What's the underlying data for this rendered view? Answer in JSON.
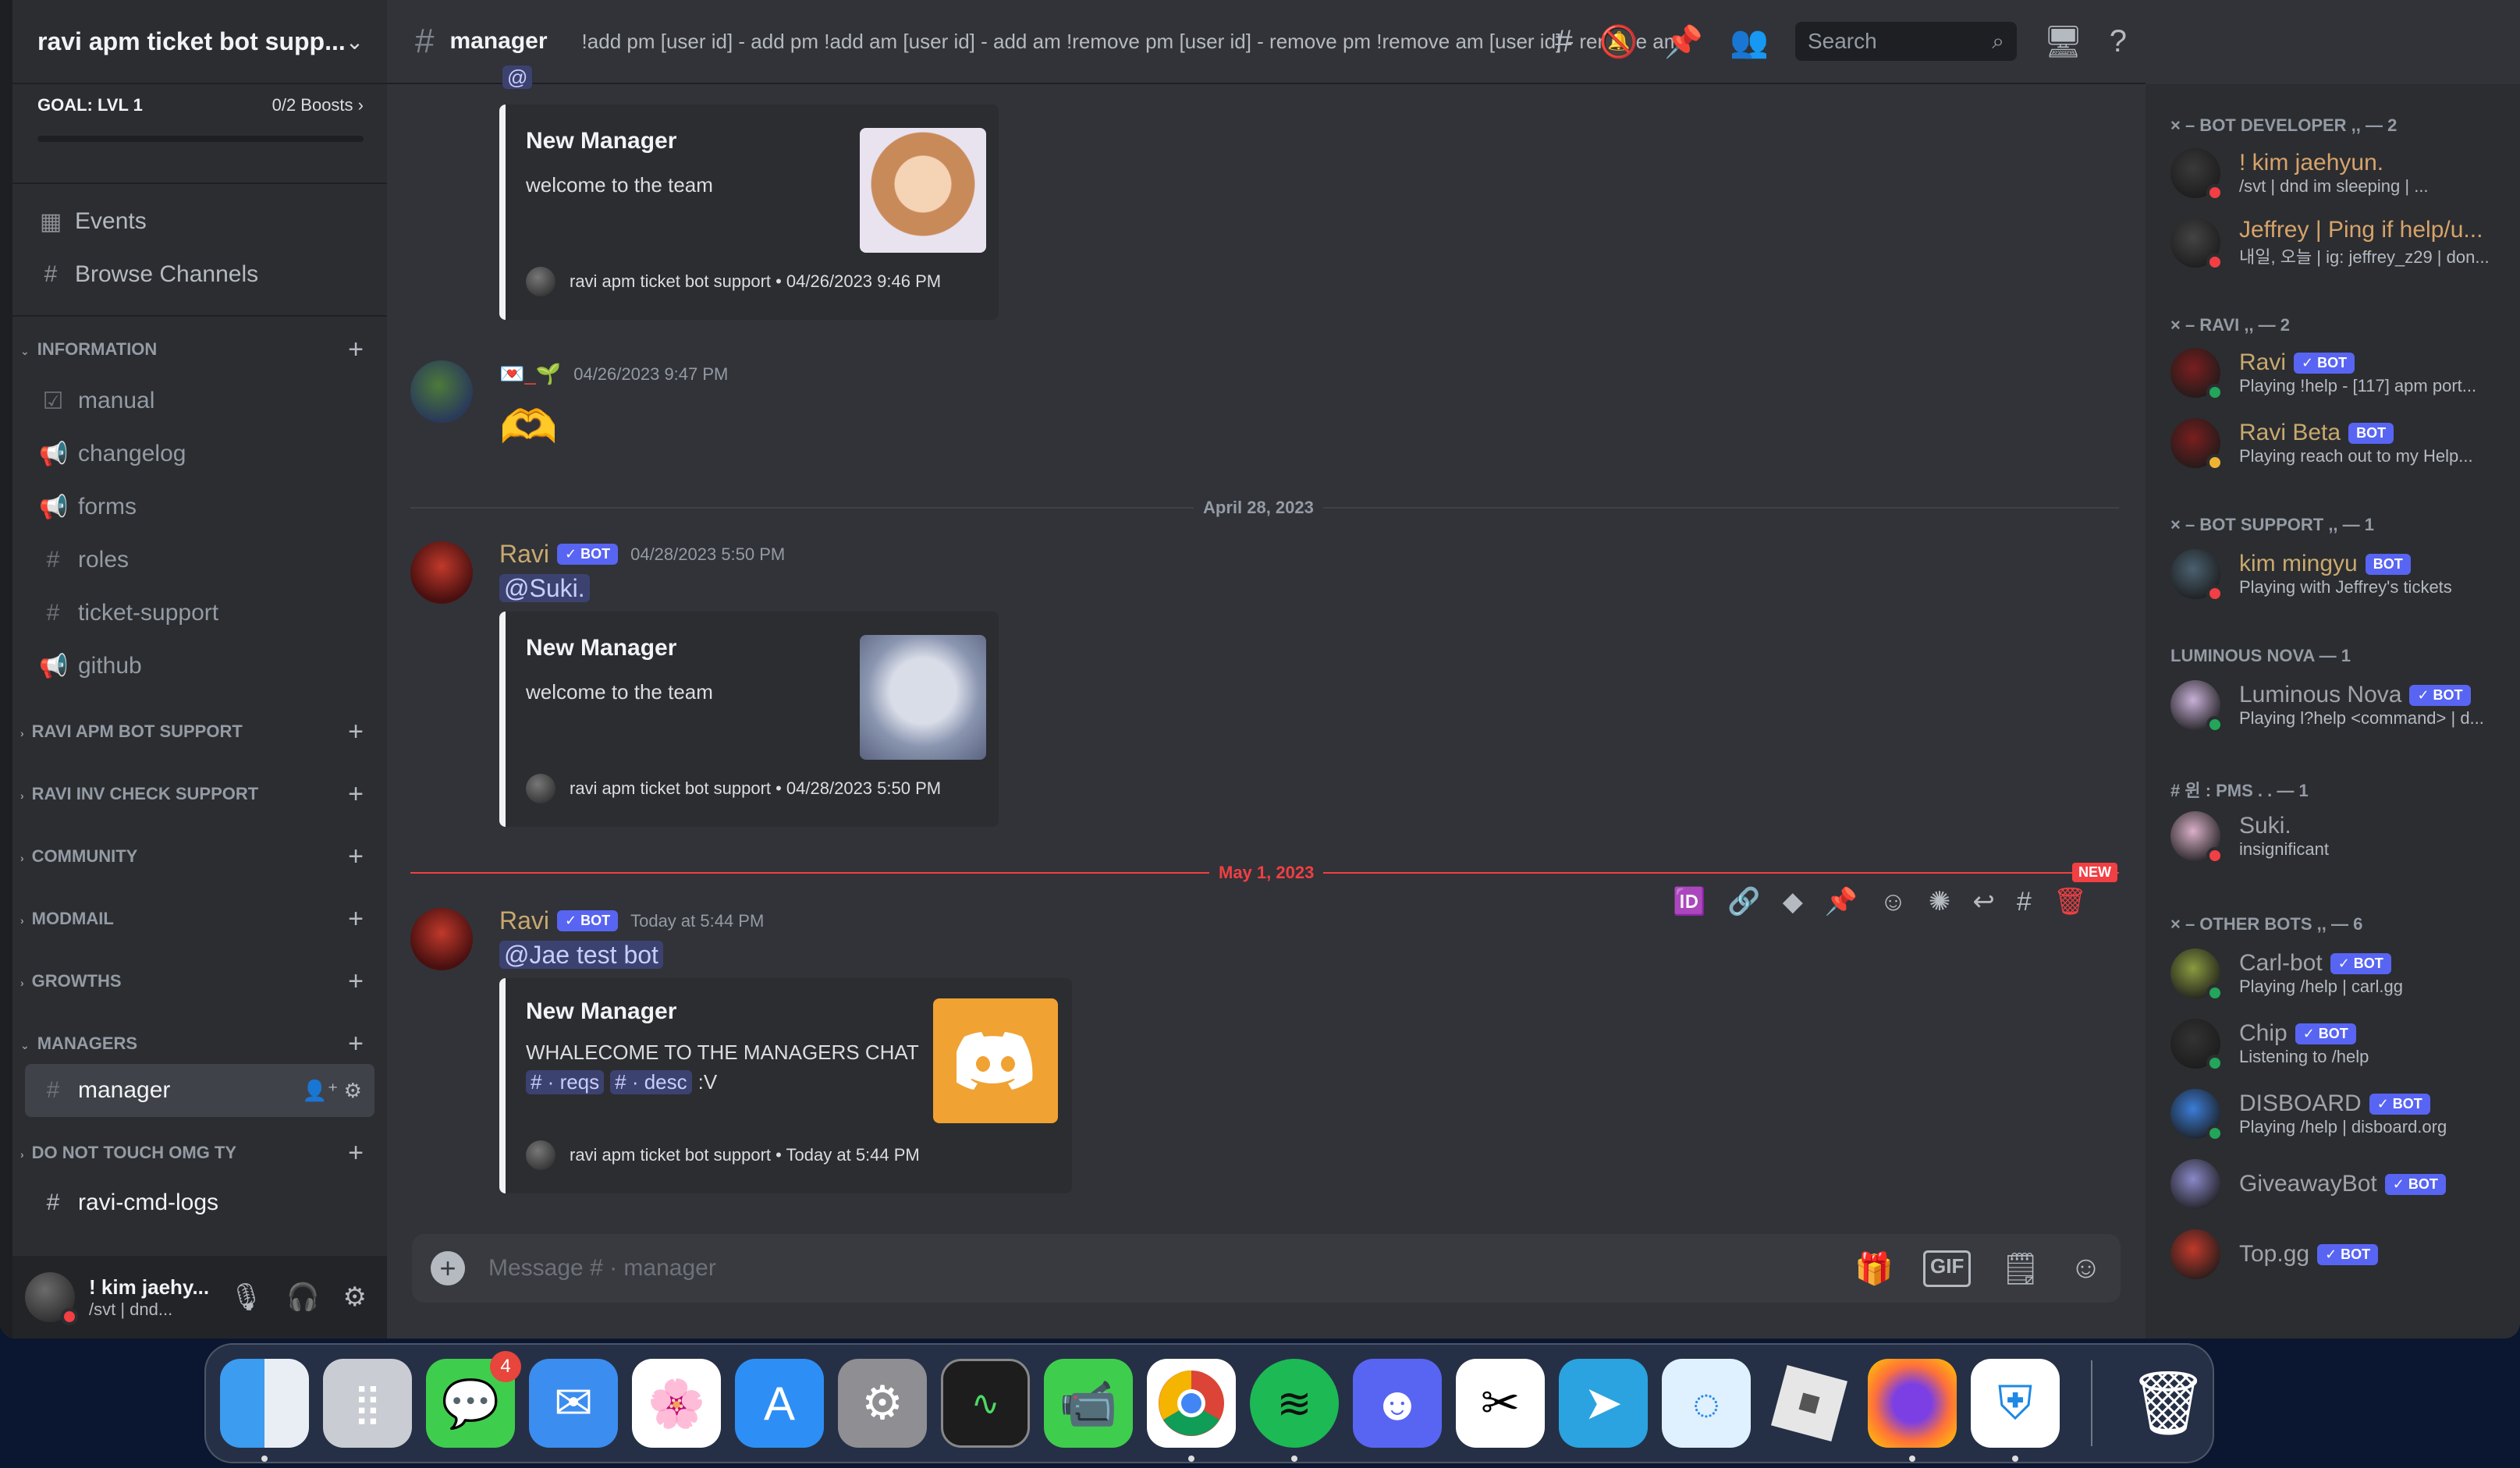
{
  "sidebar": {
    "server_name": "ravi apm ticket bot supp...",
    "goal_label": "GOAL: LVL 1",
    "goal_boosts": "0/2 Boosts",
    "links": [
      {
        "label": "Events",
        "icon": "calendar-icon"
      },
      {
        "label": "Browse Channels",
        "icon": "browse-channels-icon"
      }
    ],
    "info_category": "INFORMATION",
    "info_channels": [
      "manual",
      "changelog",
      "forms",
      "roles",
      "ticket-support",
      "github"
    ],
    "categories": [
      "RAVI APM BOT SUPPORT",
      "RAVI INV CHECK SUPPORT",
      "COMMUNITY",
      "MODMAIL",
      "GROWTHS",
      "MANAGERS"
    ],
    "active_channel": "manager",
    "last_category": "DO NOT TOUCH OMG TY",
    "last_channel": "ravi-cmd-logs",
    "user": {
      "name": "! kim jaehy...",
      "status": "/svt | dnd..."
    }
  },
  "header": {
    "channel": "manager",
    "topic": "!add pm [user id] - add pm !add am [user id] - add am !remove pm [user id] - remove pm !remove am [user id] - remove am",
    "search_placeholder": "Search"
  },
  "messages": {
    "m1": {
      "mention_partial": "@",
      "embed_title": "New Manager",
      "embed_desc": "welcome to the team",
      "embed_footer": "ravi apm ticket bot support • 04/26/2023 9:46 PM"
    },
    "m2": {
      "timestamp": "04/26/2023 9:47 PM",
      "emoji": "🫶"
    },
    "divider1": "April 28, 2023",
    "m3": {
      "author": "Ravi",
      "bot_tag": "✓ BOT",
      "timestamp": "04/28/2023 5:50 PM",
      "mention": "@Suki.",
      "embed_title": "New Manager",
      "embed_desc": "welcome to the team",
      "embed_footer": "ravi apm ticket bot support • 04/28/2023 5:50 PM"
    },
    "divider2": "May 1, 2023",
    "new_label": "NEW",
    "m4": {
      "author": "Ravi",
      "bot_tag": "✓ BOT",
      "timestamp": "Today at 5:44 PM",
      "mention": "@Jae test bot",
      "embed_title": "New Manager",
      "embed_desc": "WHALECOME TO THE MANAGERS CHAT",
      "embed_link1": "# · reqs",
      "embed_link2": "# · desc",
      "embed_suffix": ":V",
      "embed_footer": "ravi apm ticket bot support • Today at 5:44 PM"
    }
  },
  "composer": {
    "placeholder": "Message # · manager"
  },
  "members": {
    "groups": [
      {
        "title": "× – BOT DEVELOPER ,, — 2"
      },
      {
        "title": "× – RAVI ,, — 2"
      },
      {
        "title": "× – BOT SUPPORT ,, — 1"
      },
      {
        "title": "LUMINOUS NOVA — 1"
      },
      {
        "title": "# 윈 : PMS . . — 1"
      },
      {
        "title": "× – OTHER BOTS ,, — 6"
      }
    ],
    "list": [
      {
        "name": "! kim jaehyun.",
        "activity": "/svt | dnd im sleeping | ...",
        "status": "dnd",
        "bot": false
      },
      {
        "name": "Jeffrey | Ping if help/u...",
        "activity": "내일, 오늘 | ig: jeffrey_z29 | don...",
        "status": "dnd",
        "bot": false
      },
      {
        "name": "Ravi",
        "activity": "Playing !help - [117] apm port...",
        "status": "online",
        "bot": true,
        "bot_label": "✓ BOT"
      },
      {
        "name": "Ravi Beta",
        "activity": "Playing reach out to my Help...",
        "status": "idle",
        "bot": true,
        "bot_label": "BOT"
      },
      {
        "name": "kim mingyu",
        "activity": "Playing with Jeffrey's tickets",
        "status": "dnd",
        "bot": true,
        "bot_label": "BOT"
      },
      {
        "name": "Luminous Nova",
        "activity": "Playing l?help <command> | d...",
        "status": "online",
        "bot": true,
        "bot_label": "✓ BOT"
      },
      {
        "name": "Suki.",
        "activity": "insignificant",
        "status": "dnd",
        "bot": false
      },
      {
        "name": "Carl-bot",
        "activity": "Playing /help | carl.gg",
        "status": "online",
        "bot": true,
        "bot_label": "✓ BOT"
      },
      {
        "name": "Chip",
        "activity": "Listening to /help",
        "status": "online",
        "bot": true,
        "bot_label": "✓ BOT"
      },
      {
        "name": "DISBOARD",
        "activity": "Playing /help | disboard.org",
        "status": "online",
        "bot": true,
        "bot_label": "✓ BOT"
      },
      {
        "name": "GiveawayBot",
        "activity": "",
        "status": "none",
        "bot": true,
        "bot_label": "✓ BOT"
      },
      {
        "name": "Top.gg",
        "activity": "",
        "status": "none",
        "bot": true,
        "bot_label": "✓ BOT"
      }
    ]
  },
  "dock": {
    "messages_badge": "4"
  },
  "colors": {
    "accent": "#5865f2",
    "dnd": "#f23f43",
    "online": "#23a55a",
    "new_divider": "#f23f43"
  }
}
